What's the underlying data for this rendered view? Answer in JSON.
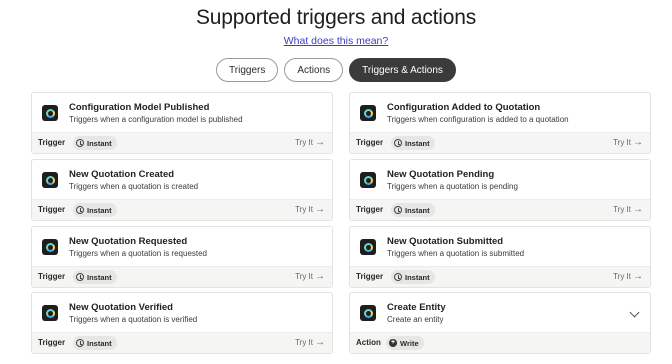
{
  "header": {
    "title": "Supported triggers and actions",
    "link": "What does this mean?"
  },
  "tabs": [
    {
      "label": "Triggers",
      "active": false
    },
    {
      "label": "Actions",
      "active": false
    },
    {
      "label": "Triggers & Actions",
      "active": true
    }
  ],
  "cards": [
    {
      "title": "Configuration Model Published",
      "desc": "Triggers when a configuration model is published",
      "kind": "Trigger",
      "badge": "Instant",
      "cta": "Try It"
    },
    {
      "title": "Configuration Added to Quotation",
      "desc": "Triggers when configuration is added to a quotation",
      "kind": "Trigger",
      "badge": "Instant",
      "cta": "Try It"
    },
    {
      "title": "New Quotation Created",
      "desc": "Triggers when a quotation is created",
      "kind": "Trigger",
      "badge": "Instant",
      "cta": "Try It"
    },
    {
      "title": "New Quotation Pending",
      "desc": "Triggers when a quotation is pending",
      "kind": "Trigger",
      "badge": "Instant",
      "cta": "Try It"
    },
    {
      "title": "New Quotation Requested",
      "desc": "Triggers when a quotation is requested",
      "kind": "Trigger",
      "badge": "Instant",
      "cta": "Try It"
    },
    {
      "title": "New Quotation Submitted",
      "desc": "Triggers when a quotation is submitted",
      "kind": "Trigger",
      "badge": "Instant",
      "cta": "Try It"
    },
    {
      "title": "New Quotation Verified",
      "desc": "Triggers when a quotation is verified",
      "kind": "Trigger",
      "badge": "Instant",
      "cta": "Try It"
    },
    {
      "title": "Create Entity",
      "desc": "Create an entity",
      "kind": "Action",
      "badge": "Write",
      "cta": ""
    }
  ],
  "icons": {
    "arrow": "→",
    "write": "+"
  }
}
